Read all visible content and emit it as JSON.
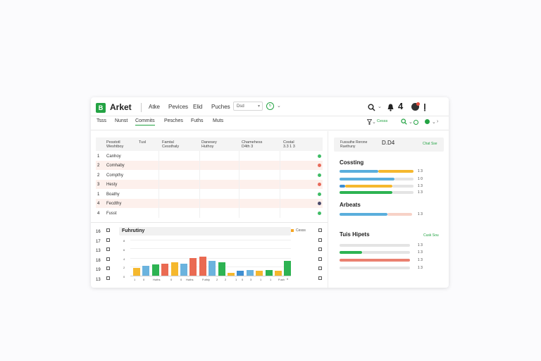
{
  "header": {
    "title": "Arket",
    "logo_letter": "B",
    "menu": [
      "Atke",
      "Pevices",
      "Elid",
      "Puches"
    ],
    "dropdown": "Dsd",
    "right_number": "4",
    "brand_color": "#23a343"
  },
  "tabs": [
    "Tsss",
    "Nunst",
    "Commits",
    "Pesches",
    "Fuths",
    "Muts"
  ],
  "toolbar2": {
    "dropdown": "Cesss"
  },
  "table": {
    "headers": [
      [
        "Pesstotl",
        "Weshtboy"
      ],
      [
        "Tusl"
      ],
      [
        "Famtal",
        "Cessthaly"
      ],
      [
        "Danesey",
        "Huthoy"
      ],
      [
        "Chamehess",
        "D4th 3"
      ],
      [
        "Costal",
        "3.3 1 3"
      ]
    ],
    "rows": [
      {
        "num": "1",
        "name": "Canhoy",
        "status": "#3fbc66"
      },
      {
        "num": "2",
        "name": "Comhaby",
        "status": "#e86a5a"
      },
      {
        "num": "2",
        "name": "Compthy",
        "status": "#3fbc66"
      },
      {
        "num": "3",
        "name": "Hesty",
        "status": "#e86a5a"
      },
      {
        "num": "1",
        "name": "Boathy",
        "status": "#3fbc66"
      },
      {
        "num": "4",
        "name": "Fecdthy",
        "status": "#4a4a6a"
      },
      {
        "num": "4",
        "name": "Fusst",
        "status": "#3fbc66"
      }
    ]
  },
  "summary_card": {
    "label_top": "Fussuthe Rerone",
    "label_bottom": "Ruethuny",
    "value": "D.D4",
    "link": "Chat Sse"
  },
  "right_sections": {
    "s1_title": "Cossting",
    "s2_title": "Arbeats",
    "s3_title": "Tuis Hipets",
    "s3_link": "Cusk Sou",
    "values": [
      "1 3",
      "1 0",
      "1 3",
      "1 3"
    ],
    "s2_value": "1 3",
    "s3_values": [
      "1 3",
      "1 3",
      "1 3",
      "1 3"
    ]
  },
  "left_axis": [
    "16",
    "17",
    "13",
    "18",
    "19",
    "13"
  ],
  "chart_data": {
    "type": "bar",
    "title": "Fuhrutiny",
    "legend": [
      {
        "name": "Cesss",
        "color": "#f5a623"
      }
    ],
    "y_ticks": [
      "8",
      "6",
      "4",
      "2",
      "0"
    ],
    "ylim": [
      0,
      10
    ],
    "categories": [
      "1",
      "0",
      "Huths",
      "0",
      "0",
      "Huths",
      "",
      "Futhly",
      "2",
      "2",
      "1",
      "0",
      "3",
      "1",
      "1",
      "Fush",
      "0"
    ],
    "values": [
      2.2,
      2.6,
      3.1,
      3.3,
      3.6,
      3.3,
      4.8,
      5.2,
      4.0,
      3.6,
      0.8,
      1.4,
      1.5,
      1.4,
      1.6,
      1.4,
      4.1
    ],
    "colors": [
      "#f5b82e",
      "#6bb3de",
      "#2db352",
      "#ea6a52",
      "#f5b82e",
      "#6bb3de",
      "#ea6a52",
      "#ea6a52",
      "#6bb3de",
      "#2db352",
      "#f5b82e",
      "#3f8ed1",
      "#6bb3de",
      "#f5b82e",
      "#2db352",
      "#f5b82e",
      "#2db352"
    ],
    "grid": true
  }
}
